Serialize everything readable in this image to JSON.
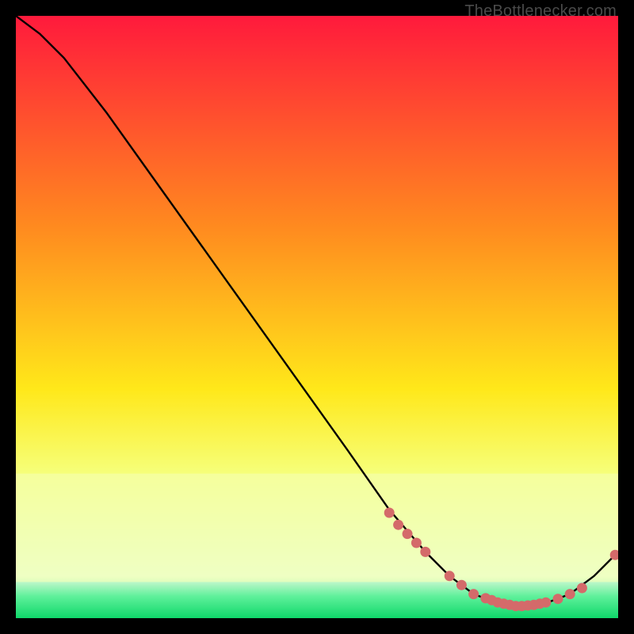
{
  "credit": "TheBottlenecker.com",
  "chart_data": {
    "type": "line",
    "title": "",
    "xlabel": "",
    "ylabel": "",
    "xlim": [
      0,
      100
    ],
    "ylim": [
      0,
      100
    ],
    "gradient": {
      "top": "#ff1a3c",
      "upper_mid": "#ff8a1f",
      "mid": "#ffe81a",
      "lower_yellow": "#f6ff7a",
      "pale": "#e8ffd0",
      "green": "#19e87a"
    },
    "green_band_top_pct": 94,
    "pale_band_top_pct": 76,
    "series": [
      {
        "name": "curve",
        "x": [
          0,
          4,
          8,
          15,
          25,
          35,
          45,
          55,
          62,
          68,
          72,
          76,
          80,
          84,
          88,
          92,
          96,
          100
        ],
        "y": [
          100,
          97,
          93,
          84,
          70,
          56,
          42,
          28,
          18,
          11,
          7,
          4,
          2.5,
          2,
          2.5,
          4,
          7,
          11
        ]
      }
    ],
    "markers": {
      "name": "points",
      "color": "#d46a6a",
      "x": [
        62,
        63.5,
        65,
        66.5,
        68,
        72,
        74,
        76,
        78,
        79,
        80,
        81,
        82,
        83,
        84,
        85,
        86,
        87,
        88,
        90,
        92,
        94,
        99.5
      ],
      "y": [
        17.5,
        15.5,
        14,
        12.5,
        11,
        7,
        5.5,
        4,
        3.3,
        3,
        2.6,
        2.4,
        2.2,
        2.0,
        2.0,
        2.1,
        2.2,
        2.4,
        2.6,
        3.2,
        4.0,
        5.0,
        10.5
      ]
    }
  }
}
